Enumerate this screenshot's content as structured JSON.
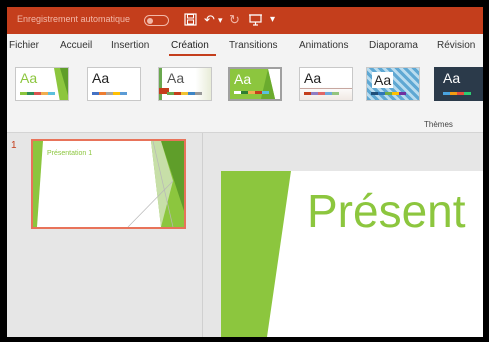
{
  "titlebar": {
    "autosave_label": "Enregistrement automatique",
    "icons": [
      "save-icon",
      "undo-icon",
      "redo-icon",
      "present-icon",
      "customize-icon"
    ],
    "undo_label": "↶",
    "redo_label": "↻",
    "customize_label": "▾",
    "background": "#c43e1c"
  },
  "tabs": [
    {
      "label": "Fichier"
    },
    {
      "label": "Accueil"
    },
    {
      "label": "Insertion"
    },
    {
      "label": "Création",
      "active": true
    },
    {
      "label": "Transitions"
    },
    {
      "label": "Animations"
    },
    {
      "label": "Diaporama"
    },
    {
      "label": "Révision"
    }
  ],
  "ribbon": {
    "group_label": "Thèmes",
    "themes": [
      {
        "label": "Aa",
        "text_color": "#8cc63e",
        "style": "green-swoosh"
      },
      {
        "label": "Aa",
        "text_color": "#222222",
        "style": "office"
      },
      {
        "label": "Aa",
        "text_color": "#555555",
        "style": "facet"
      },
      {
        "label": "Aa",
        "text_color": "#ffffff",
        "style": "green-selected",
        "selected": true
      },
      {
        "label": "Aa",
        "text_color": "#222222",
        "style": "retrospect"
      },
      {
        "label": "Aa",
        "text_color": "#222222",
        "style": "blue-pattern"
      },
      {
        "label": "Aa",
        "text_color": "#ffffff",
        "style": "dark"
      }
    ]
  },
  "slides": [
    {
      "number": "1",
      "title": "Présentation 1"
    }
  ],
  "main_slide": {
    "title": "Présent",
    "accent": "#8cc63e"
  }
}
